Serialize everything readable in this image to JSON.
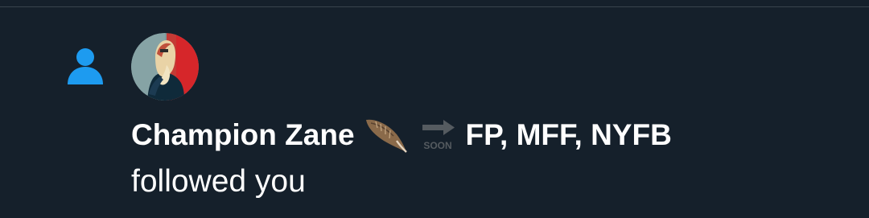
{
  "notification": {
    "type_icon": "person-icon",
    "avatar": "user-avatar-image",
    "user": {
      "display_name": "Champion Zane",
      "emojis": [
        "feather-emoji",
        "soon-arrow-emoji"
      ],
      "name_suffix": "FP, MFF, NYFB"
    },
    "action_text": "followed you"
  },
  "colors": {
    "background": "#15202b",
    "accent": "#1d9bf0",
    "text": "#ffffff",
    "divider": "#38444d"
  }
}
